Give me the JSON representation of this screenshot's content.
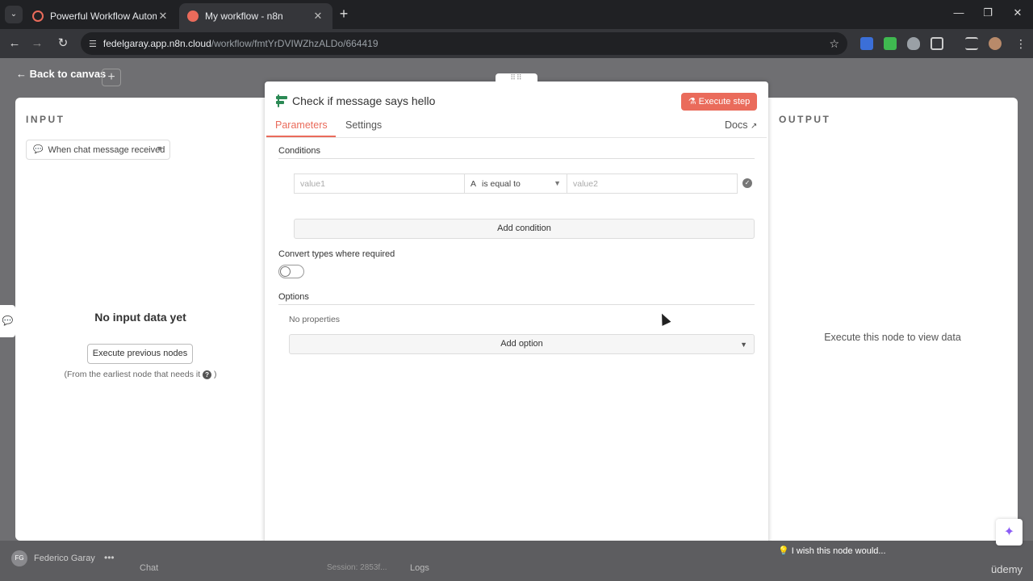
{
  "browser": {
    "tabs": [
      {
        "title": "Powerful Workflow Automation",
        "active": false
      },
      {
        "title": "My workflow - n8n",
        "active": true
      }
    ],
    "url_host": "fedelgaray.app.n8n.cloud",
    "url_path": "/workflow/fmtYrDVIWZhzALDo/664419",
    "extension_badge": "0"
  },
  "canvas": {
    "back_label": "Back to canvas"
  },
  "input": {
    "label": "INPUT",
    "source": "When chat message received",
    "empty_title": "No input data yet",
    "exec_prev_label": "Execute previous nodes",
    "hint": "(From the earliest node that needs it",
    "hint_end": ")"
  },
  "output": {
    "label": "OUTPUT",
    "empty_msg": "Execute this node to view data"
  },
  "node": {
    "title": "Check if message says hello",
    "execute_label": "Execute step",
    "tabs": {
      "parameters": "Parameters",
      "settings": "Settings"
    },
    "docs_label": "Docs",
    "conditions_label": "Conditions",
    "condition": {
      "value1_placeholder": "value1",
      "operator": "is equal to",
      "value2_placeholder": "value2"
    },
    "add_condition_label": "Add condition",
    "convert_label": "Convert types where required",
    "convert_enabled": false,
    "options_label": "Options",
    "no_properties": "No properties",
    "add_option_label": "Add option"
  },
  "footer": {
    "user_initials": "FG",
    "user_name": "Federico Garay",
    "chat_label": "Chat",
    "session_label": "Session: 2853f...",
    "logs_label": "Logs",
    "wish_label": "I wish this node would...",
    "watermark": "üdemy"
  },
  "colors": {
    "accent": "#ea6b5b",
    "node_icon": "#2c8a55"
  }
}
